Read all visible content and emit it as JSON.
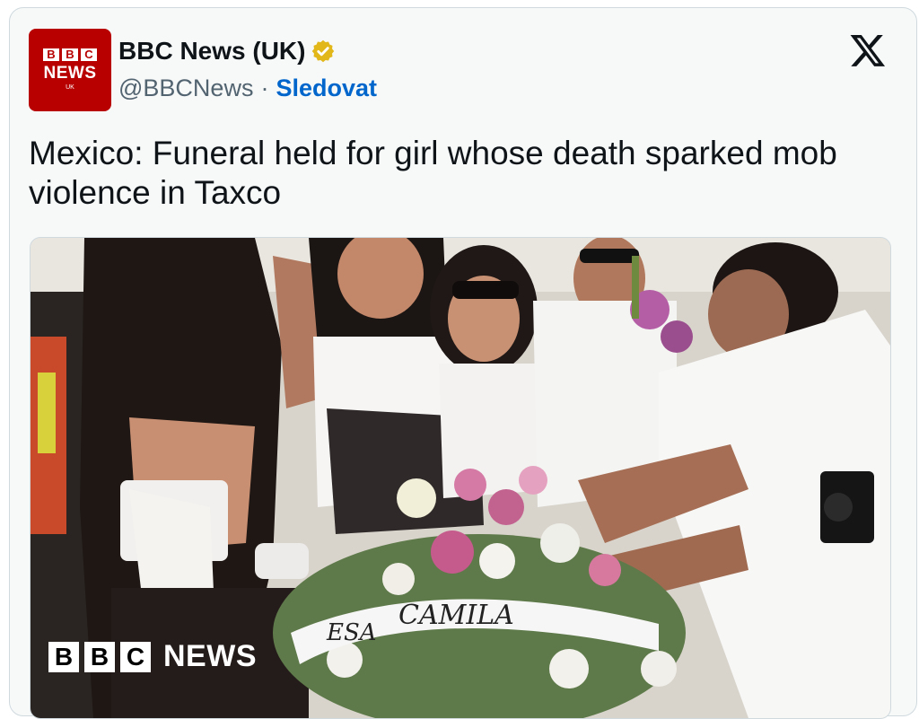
{
  "account": {
    "logo_letters": [
      "B",
      "B",
      "C"
    ],
    "logo_news": "NEWS",
    "logo_region": "UK",
    "name": "BBC News (UK)",
    "handle": "@BBCNews",
    "separator": "·",
    "follow_label": "Sledovat"
  },
  "tweet": {
    "text": "Mexico: Funeral held for girl whose death sparked mob violence in Taxco"
  },
  "media": {
    "ribbon_text": "CAMILA",
    "ribbon_text_partial": "ESA",
    "watermark_letters": [
      "B",
      "B",
      "C"
    ],
    "watermark_news": "NEWS"
  },
  "colors": {
    "bbc_red": "#b80000",
    "verified_gold": "#e2b719",
    "follow_blue": "#0066cc"
  },
  "icons": {
    "verified": "verified-badge-icon",
    "platform": "x-logo-icon"
  }
}
